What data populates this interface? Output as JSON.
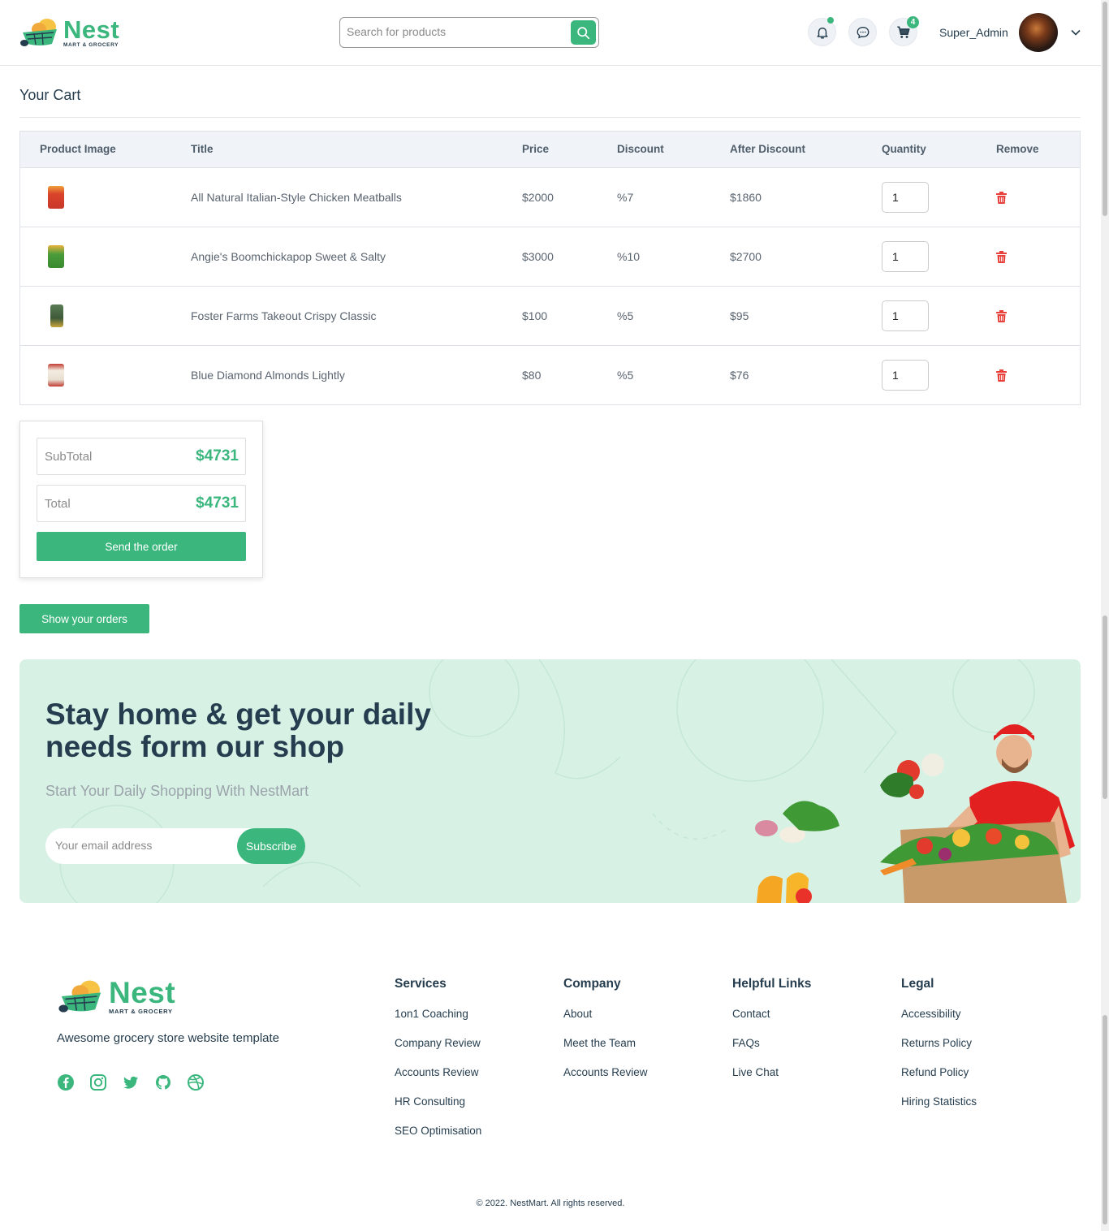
{
  "brand": {
    "name": "Nest",
    "tagline_small": "MART & GROCERY"
  },
  "header": {
    "search_placeholder": "Search for products",
    "cart_count": "4",
    "username": "Super_Admin"
  },
  "cart": {
    "title": "Your Cart",
    "columns": [
      "Product Image",
      "Title",
      "Price",
      "Discount",
      "After Discount",
      "Quantity",
      "Remove"
    ],
    "rows": [
      {
        "title": "All Natural Italian-Style Chicken Meatballs",
        "price": "$2000",
        "discount": "%7",
        "after": "$1860",
        "qty": "1",
        "img_color": "#d9442b"
      },
      {
        "title": "Angie's Boomchickapop Sweet & Salty",
        "price": "$3000",
        "discount": "%10",
        "after": "$2700",
        "qty": "1",
        "img_color": "#4a9c3b"
      },
      {
        "title": "Foster Farms Takeout Crispy Classic",
        "price": "$100",
        "discount": "%5",
        "after": "$95",
        "qty": "1",
        "img_color": "#3e5a3a"
      },
      {
        "title": "Blue Diamond Almonds Lightly",
        "price": "$80",
        "discount": "%5",
        "after": "$76",
        "qty": "1",
        "img_color": "#c23b32"
      }
    ]
  },
  "totals": {
    "subtotal_label": "SubTotal",
    "subtotal": "$4731",
    "total_label": "Total",
    "total": "$4731",
    "send_label": "Send the order",
    "orders_label": "Show your orders"
  },
  "banner": {
    "headline": "Stay home & get your daily needs form our shop",
    "subtitle": "Start Your Daily Shopping With NestMart",
    "email_placeholder": "Your email address",
    "subscribe_label": "Subscribe"
  },
  "footer": {
    "tagline": "Awesome grocery store website template",
    "columns": [
      {
        "heading": "Services",
        "links": [
          "1on1 Coaching",
          "Company Review",
          "Accounts Review",
          "HR Consulting",
          "SEO Optimisation"
        ]
      },
      {
        "heading": "Company",
        "links": [
          "About",
          "Meet the Team",
          "Accounts Review"
        ]
      },
      {
        "heading": "Helpful Links",
        "links": [
          "Contact",
          "FAQs",
          "Live Chat"
        ]
      },
      {
        "heading": "Legal",
        "links": [
          "Accessibility",
          "Returns Policy",
          "Refund Policy",
          "Hiring Statistics"
        ]
      }
    ],
    "copyright": "© 2022. NestMart. All rights reserved."
  },
  "colors": {
    "accent": "#3bb77e",
    "heading": "#253d4e",
    "danger": "#e8403a",
    "banner_bg": "#d8f1e5"
  },
  "icons": [
    "search-icon",
    "bell-icon",
    "chat-icon",
    "cart-icon",
    "chevron-down-icon",
    "trash-icon",
    "facebook-icon",
    "instagram-icon",
    "twitter-icon",
    "github-icon",
    "dribbble-icon"
  ]
}
